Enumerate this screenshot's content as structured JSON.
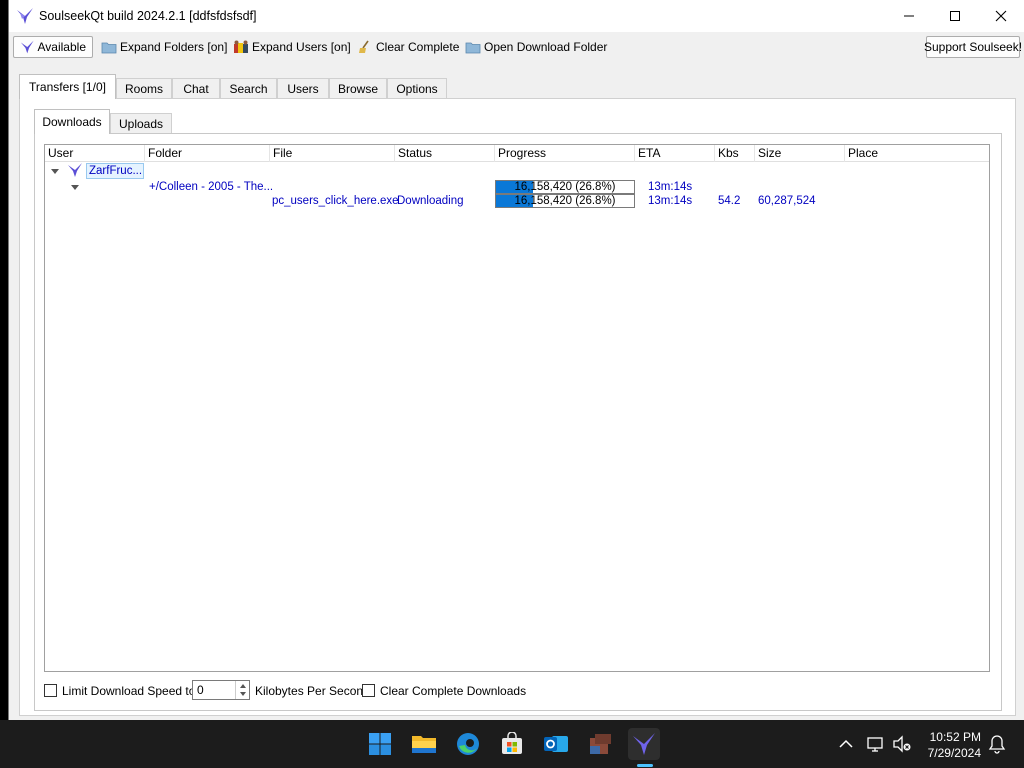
{
  "window": {
    "title": "SoulseekQt build 2024.2.1 [ddfsfdsfsdf]"
  },
  "toolbar": {
    "available_label": "Available",
    "expand_folders_label": "Expand Folders [on]",
    "expand_users_label": "Expand Users [on]",
    "clear_complete_label": "Clear Complete",
    "open_download_folder_label": "Open Download Folder",
    "support_label": "Support Soulseek!"
  },
  "main_tabs": [
    {
      "label": "Transfers [1/0]",
      "active": true
    },
    {
      "label": "Rooms"
    },
    {
      "label": "Chat"
    },
    {
      "label": "Search"
    },
    {
      "label": "Users"
    },
    {
      "label": "Browse"
    },
    {
      "label": "Options"
    }
  ],
  "sub_tabs": [
    {
      "label": "Downloads",
      "active": true
    },
    {
      "label": "Uploads"
    }
  ],
  "table": {
    "columns": [
      "User",
      "Folder",
      "File",
      "Status",
      "Progress",
      "ETA",
      "Kbs",
      "Size",
      "Place"
    ],
    "user_row": {
      "user": "ZarfFruc..."
    },
    "folder_row": {
      "folder": "+/Colleen - 2005 - The...",
      "progress_text": "16,158,420 (26.8%)",
      "progress_fraction": 0.268,
      "eta": "13m:14s"
    },
    "file_row": {
      "file": "pc_users_click_here.exe",
      "status": "Downloading",
      "progress_text": "16,158,420 (26.8%)",
      "progress_fraction": 0.268,
      "eta": "13m:14s",
      "kbs": "54.2",
      "size": "60,287,524"
    }
  },
  "bottom": {
    "limit_label": "Limit Download Speed to",
    "limit_value": "0",
    "kbps_label": "Kilobytes Per Second",
    "clear_complete_downloads_label": "Clear Complete Downloads"
  },
  "taskbar": {
    "time": "10:52 PM",
    "date": "7/29/2024"
  },
  "colors": {
    "progress_fill": "#0a78d7",
    "link_text": "#0000c0",
    "taskbar_bg": "#1c1c1c"
  }
}
